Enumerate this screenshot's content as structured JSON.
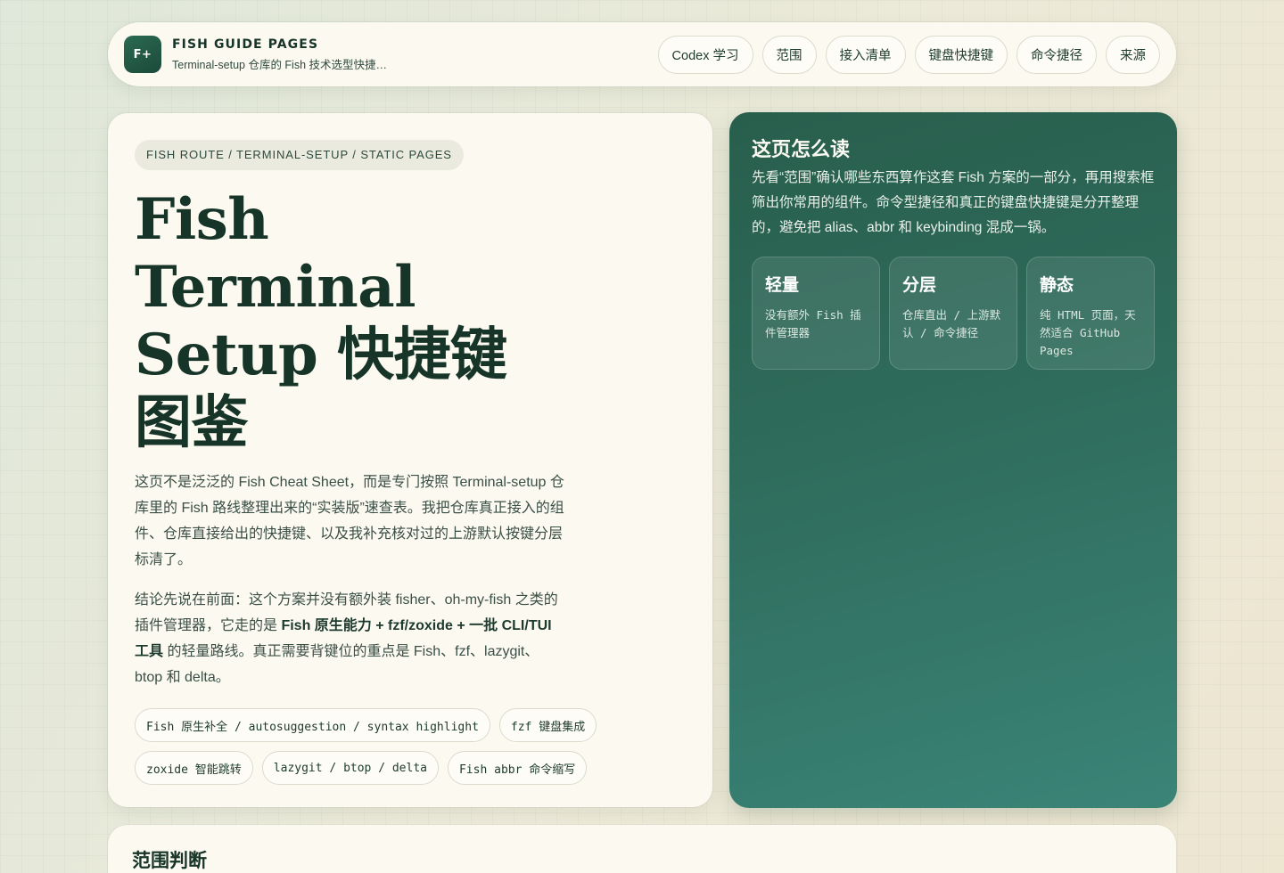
{
  "header": {
    "logo": "F+",
    "title": "FISH GUIDE PAGES",
    "subtitle": "Terminal-setup 仓库的 Fish 技术选型快捷…",
    "nav": [
      "Codex 学习",
      "范围",
      "接入清单",
      "键盘快捷键",
      "命令捷径",
      "来源"
    ]
  },
  "hero": {
    "eyebrow": "FISH ROUTE / TERMINAL-SETUP / STATIC PAGES",
    "title_lines": [
      "Fish",
      "Terminal",
      "Setup 快捷键",
      "图鉴"
    ],
    "intro": "这页不是泛泛的 Fish Cheat Sheet，而是专门按照 Terminal-setup 仓库里的 Fish 路线整理出来的“实装版”速查表。我把仓库真正接入的组件、仓库直接给出的快捷键、以及我补充核对过的上游默认按键分层标清了。",
    "conclusion_pre": "结论先说在前面：这个方案并没有额外装 fisher、oh-my-fish 之类的插件管理器，它走的是 ",
    "conclusion_bold": "Fish 原生能力 + fzf/zoxide + 一批 CLI/TUI 工具",
    "conclusion_post": " 的轻量路线。真正需要背键位的重点是 Fish、fzf、lazygit、btop 和 delta。",
    "tags": [
      "Fish 原生补全 / autosuggestion / syntax highlight",
      "fzf 键盘集成",
      "zoxide 智能跳转",
      "lazygit / btop / delta",
      "Fish abbr 命令缩写"
    ]
  },
  "guide": {
    "title": "这页怎么读",
    "text": "先看“范围”确认哪些东西算作这套 Fish 方案的一部分，再用搜索框筛出你常用的组件。命令型捷径和真正的键盘快捷键是分开整理的，避免把 alias、abbr 和 keybinding 混成一锅。",
    "cards": [
      {
        "title": "轻量",
        "desc": "没有额外 Fish 插件管理器"
      },
      {
        "title": "分层",
        "desc": "仓库直出 / 上游默认 / 命令捷径"
      },
      {
        "title": "静态",
        "desc": "纯 HTML 页面，天然适合 GitHub Pages"
      }
    ]
  },
  "section": {
    "title": "范围判断"
  }
}
